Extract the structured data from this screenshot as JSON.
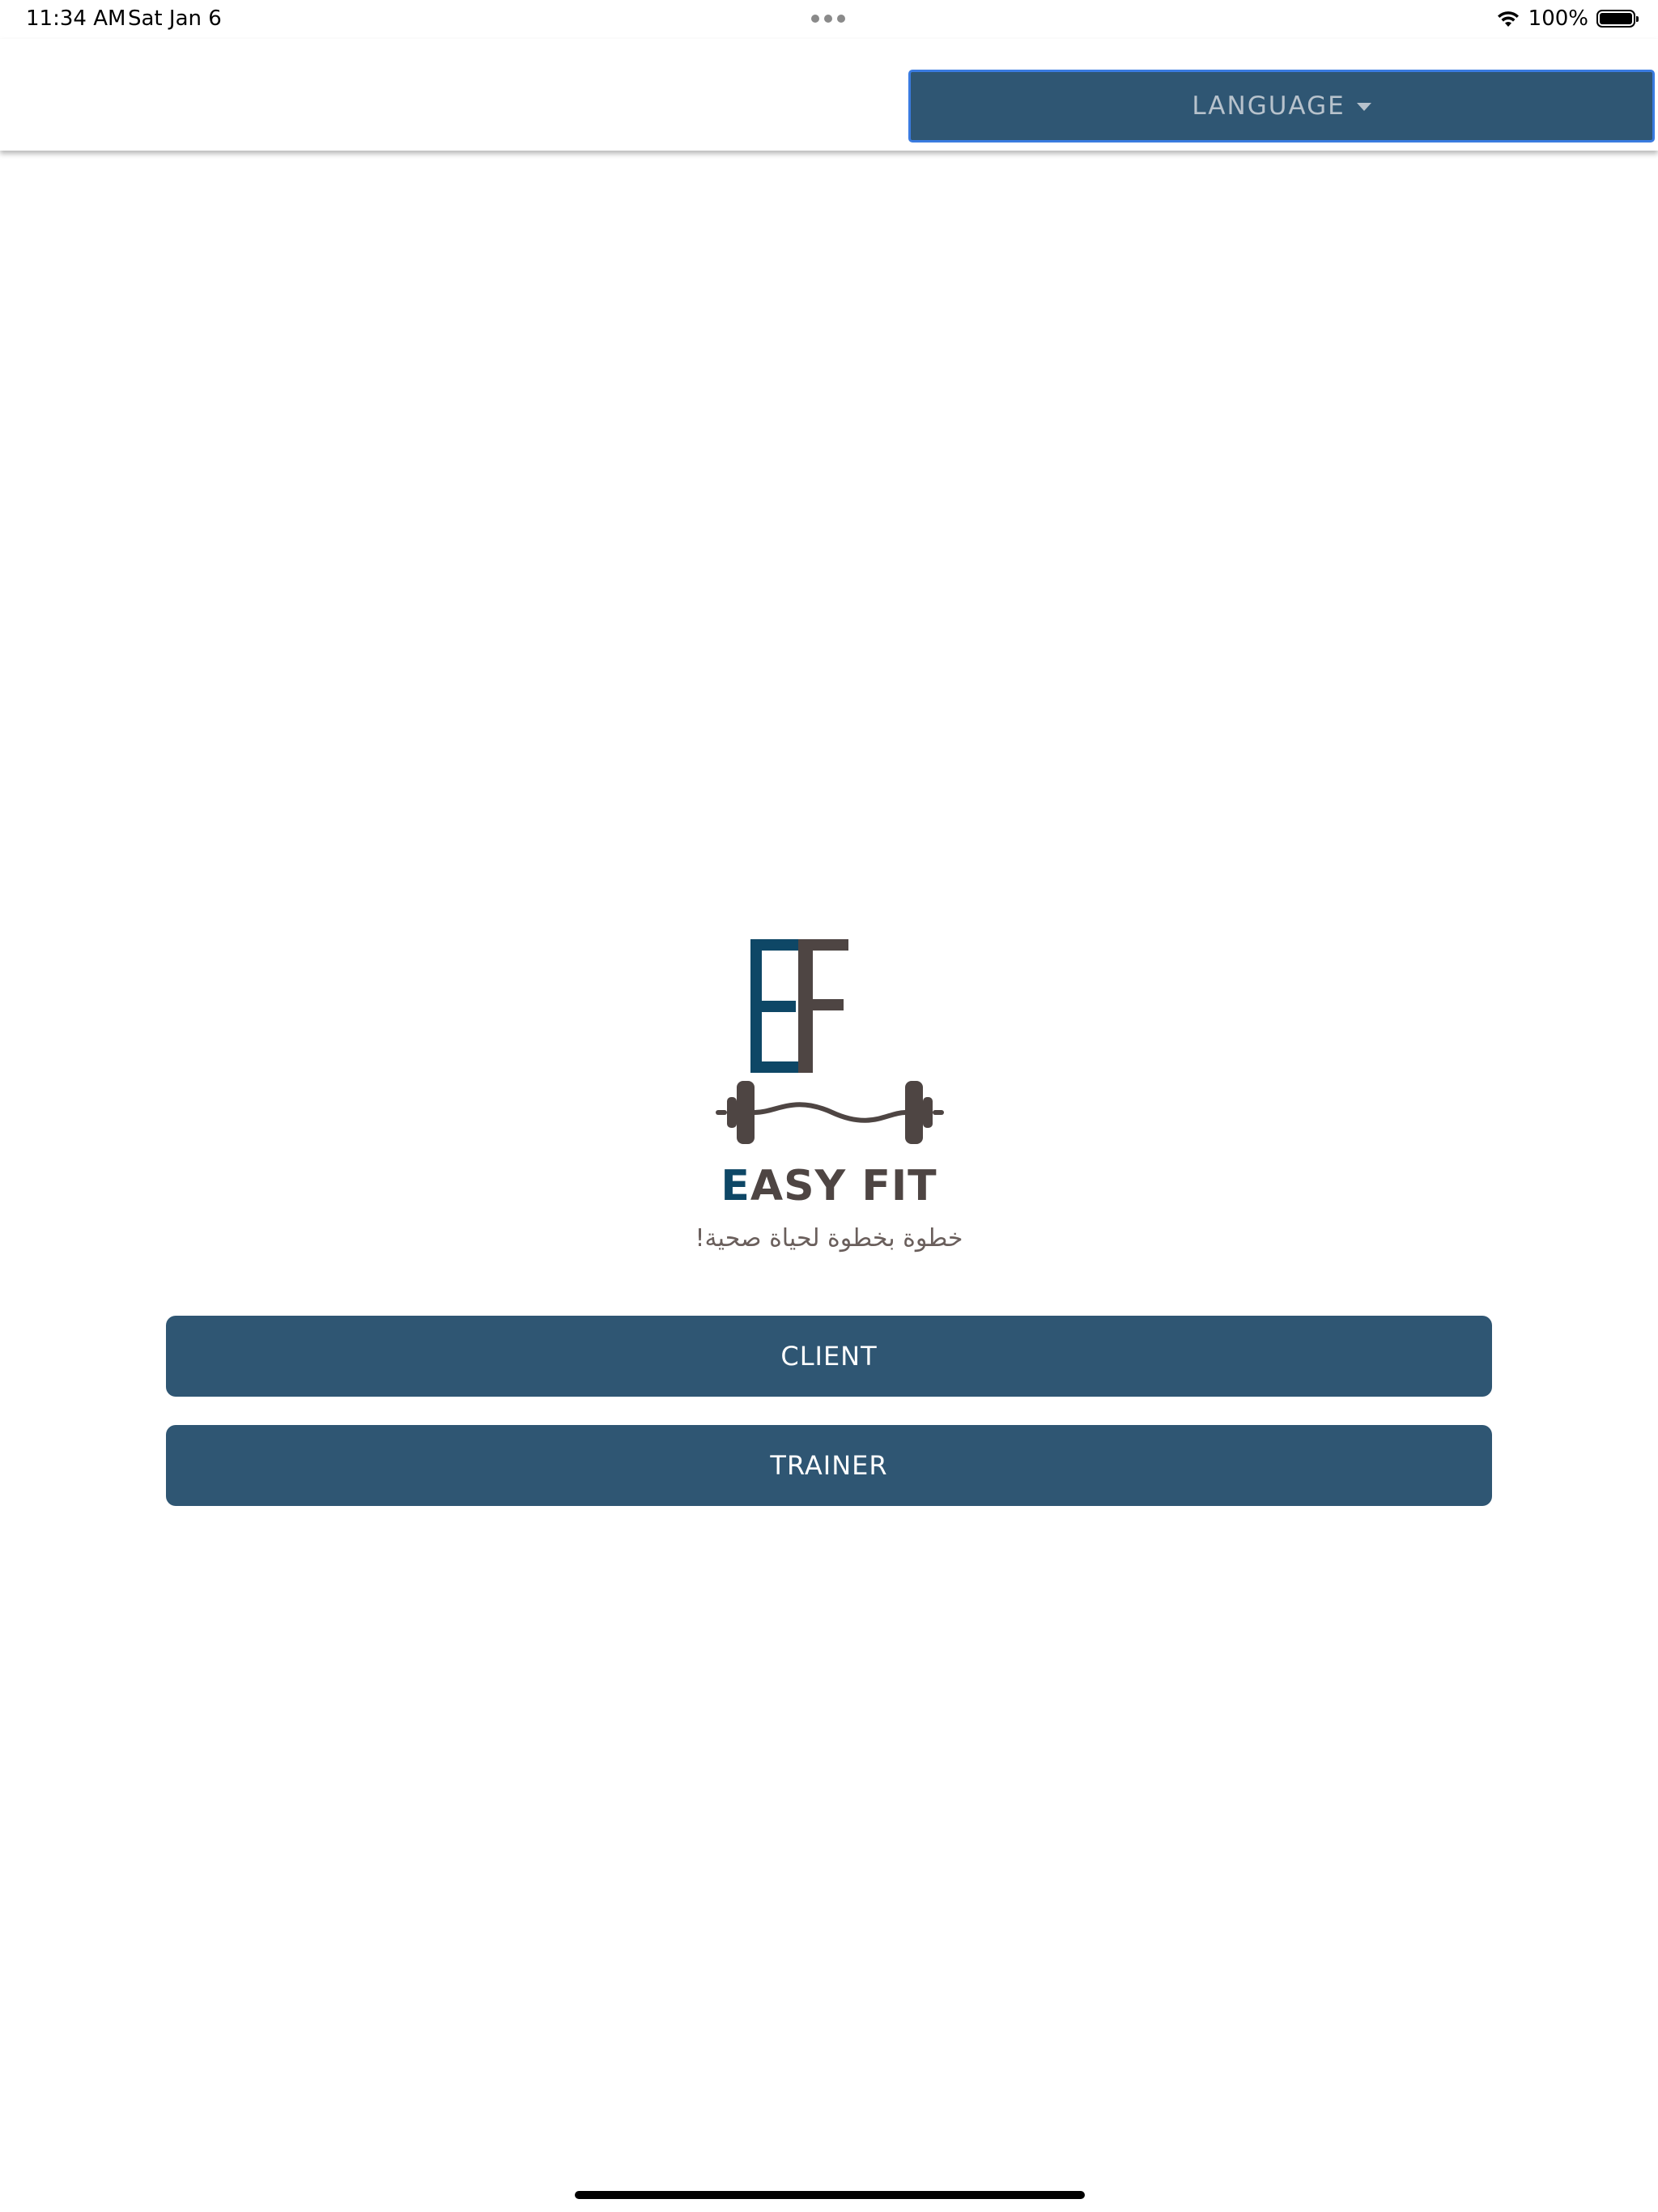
{
  "status_bar": {
    "time": "11:34 AM",
    "date": "Sat Jan 6",
    "battery": "100%"
  },
  "header": {
    "language_label": "LANGUAGE"
  },
  "brand": {
    "name_first": "E",
    "name_rest": "ASY FIT",
    "tagline": "خطوة بخطوة لحياة صحية!"
  },
  "roles": {
    "client_label": "CLIENT",
    "trainer_label": "TRAINER"
  },
  "colors": {
    "primary": "#2f5673",
    "logo_blue": "#0e4766",
    "logo_brown": "#4e4543",
    "focus_border": "#3a7be0"
  }
}
